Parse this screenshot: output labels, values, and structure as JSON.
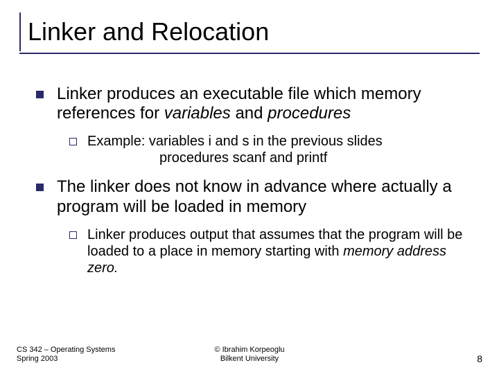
{
  "title": "Linker and Relocation",
  "bullets": [
    {
      "text_pre": "Linker produces an executable file which memory references for ",
      "italic1": "variables",
      "mid": " and ",
      "italic2": "procedures",
      "sub": {
        "line1": "Example: variables i and s in the previous slides",
        "line2": "procedures scanf and printf"
      }
    },
    {
      "text": "The linker does not know in advance where actually a program will be loaded in memory",
      "sub": {
        "pre": "Linker produces output that assumes that the program will be loaded to a place in memory starting with ",
        "italic": "memory  address zero.",
        "post": ""
      }
    }
  ],
  "footer": {
    "left_line1": "CS 342 – Operating Systems",
    "left_line2": "Spring 2003",
    "center_line1": "© Ibrahim Korpeoglu",
    "center_line2": "Bilkent University",
    "pagenum": "8"
  }
}
